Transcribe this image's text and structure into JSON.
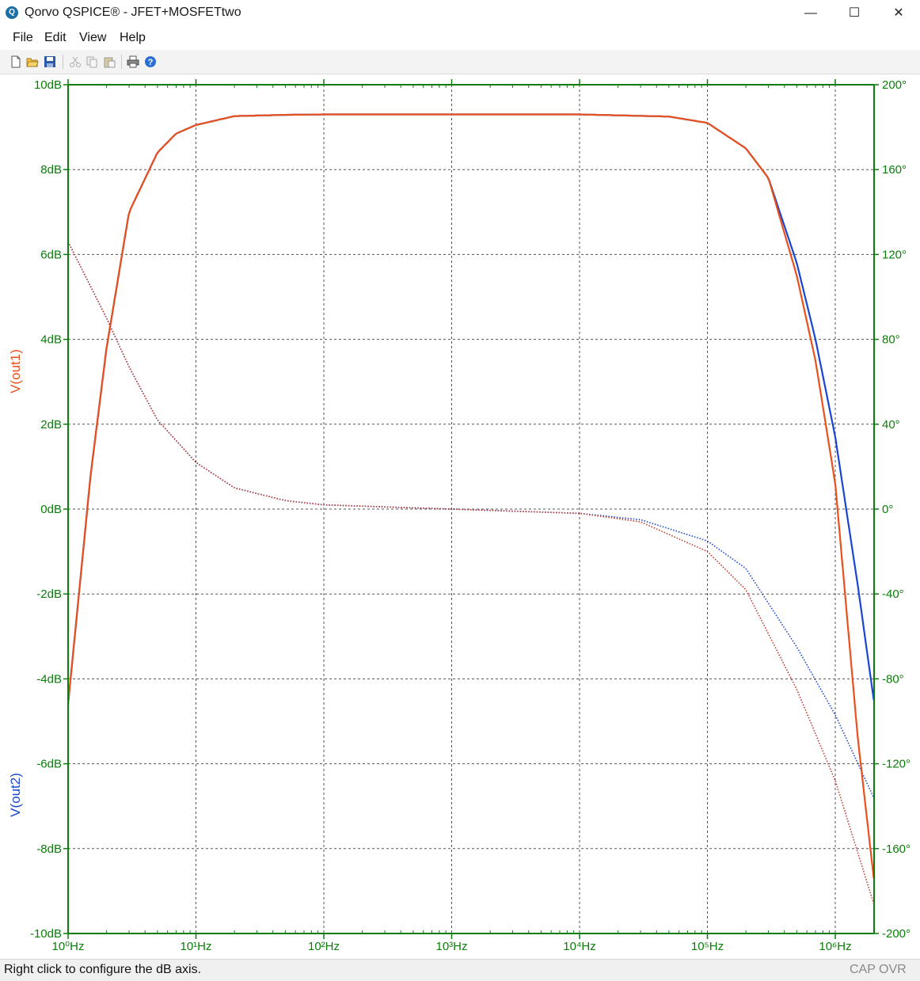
{
  "window": {
    "title": "Qorvo QSPICE® - JFET+MOSFETtwo",
    "minimize_label": "—",
    "maximize_label": "☐",
    "close_label": "✕"
  },
  "menu": [
    "File",
    "Edit",
    "View",
    "Help"
  ],
  "toolbar": {
    "icons": [
      "new-file-icon",
      "open-folder-icon",
      "save-icon",
      "cut-icon",
      "copy-icon",
      "paste-icon",
      "print-icon",
      "help-icon"
    ]
  },
  "plot": {
    "left_axis": {
      "ticks": [
        "10dB",
        "8dB",
        "6dB",
        "4dB",
        "2dB",
        "0dB",
        "-2dB",
        "-4dB",
        "-6dB",
        "-8dB",
        "-10dB"
      ]
    },
    "right_axis": {
      "ticks": [
        "200°",
        "160°",
        "120°",
        "80°",
        "40°",
        "0°",
        "-40°",
        "-80°",
        "-120°",
        "-160°",
        "-200°"
      ]
    },
    "x_axis": {
      "ticks": [
        "10⁰Hz",
        "10¹Hz",
        "10²Hz",
        "10³Hz",
        "10⁴Hz",
        "10⁵Hz",
        "10⁶Hz"
      ]
    },
    "colors": {
      "axis": "#0a7d0a",
      "grid": "#555555",
      "out1": "#e8501c",
      "out1_phase": "#c0392b",
      "out2": "#1a44d4"
    }
  },
  "chart_data": {
    "type": "line",
    "xlabel": "",
    "ylabel": "",
    "x_scale": "log",
    "xlim": [
      1,
      2000000
    ],
    "ylim": [
      -10,
      10
    ],
    "y2lim": [
      -200,
      200
    ],
    "grid": true,
    "series": [
      {
        "name": "V(out1)",
        "kind": "magnitude_dB",
        "x": [
          1,
          1.5,
          2,
          3,
          5,
          7,
          10,
          20,
          50,
          100,
          1000,
          10000,
          50000,
          100000,
          200000,
          300000,
          500000,
          700000,
          1000000,
          1500000,
          2000000
        ],
        "values": [
          -4.6,
          0.8,
          3.8,
          7.0,
          8.4,
          8.85,
          9.05,
          9.26,
          9.29,
          9.3,
          9.3,
          9.3,
          9.25,
          9.1,
          8.5,
          7.8,
          5.5,
          3.5,
          0.6,
          -5.4,
          -8.7
        ]
      },
      {
        "name": "V(out2)",
        "kind": "magnitude_dB",
        "x": [
          1,
          1.5,
          2,
          3,
          5,
          7,
          10,
          20,
          50,
          100,
          1000,
          10000,
          50000,
          100000,
          200000,
          300000,
          500000,
          700000,
          1000000,
          1500000,
          2000000
        ],
        "values": [
          -4.6,
          0.8,
          3.8,
          7.0,
          8.4,
          8.85,
          9.05,
          9.26,
          9.29,
          9.3,
          9.3,
          9.3,
          9.25,
          9.1,
          8.5,
          7.8,
          5.8,
          4.0,
          1.7,
          -1.8,
          -4.5
        ]
      },
      {
        "name": "V(out1) phase",
        "kind": "phase_deg",
        "x": [
          1,
          2,
          3,
          5,
          10,
          20,
          50,
          100,
          1000,
          10000,
          30000,
          100000,
          200000,
          500000,
          1000000,
          2000000
        ],
        "values": [
          126,
          90,
          67,
          42,
          22,
          10,
          4,
          2,
          0,
          -2,
          -6,
          -20,
          -38,
          -85,
          -128,
          -186
        ]
      },
      {
        "name": "V(out2) phase",
        "kind": "phase_deg",
        "x": [
          1,
          2,
          3,
          5,
          10,
          20,
          50,
          100,
          1000,
          10000,
          30000,
          100000,
          200000,
          500000,
          1000000,
          2000000
        ],
        "values": [
          126,
          90,
          67,
          42,
          22,
          10,
          4,
          2,
          0,
          -2,
          -5,
          -15,
          -28,
          -65,
          -97,
          -136
        ]
      }
    ]
  },
  "status": {
    "message": "Right click to configure the dB axis.",
    "cap": "CAP",
    "ovr": "OVR"
  }
}
